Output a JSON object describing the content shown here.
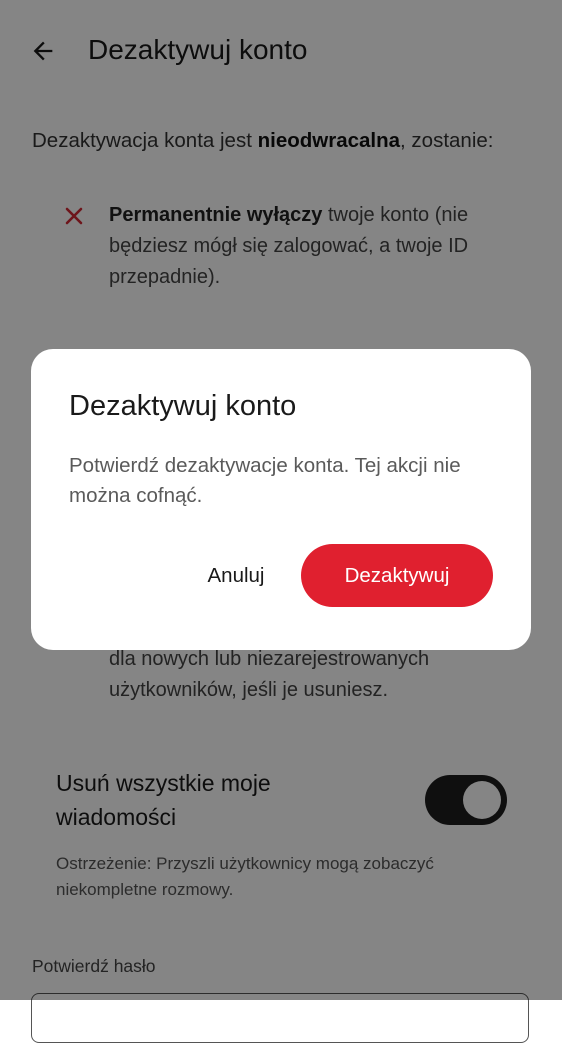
{
  "colors": {
    "accent": "#e0202f",
    "toggle_on": "#1d1d1d",
    "scrim": "rgba(0,0,0,0.48)"
  },
  "header": {
    "back_icon": "arrow-left-icon",
    "title": "Dezaktywuj konto"
  },
  "intro": {
    "prefix": "Dezaktywacja konta jest ",
    "bold": "nieodwracalna",
    "suffix": ", zostanie:"
  },
  "consequences": [
    {
      "icon": "x-icon",
      "bold": "Permanentnie wyłączy",
      "text": " twoje konto (nie będziesz mógł się zalogować, a twoje ID przepadnie)."
    },
    {
      "icon": "x-icon",
      "bold": "",
      "text": "dla nowych lub niezarejestrowanych użytkowników, jeśli je usuniesz."
    }
  ],
  "delete_messages": {
    "label": "Usuń wszystkie moje wiadomości",
    "enabled": true,
    "warning": "Ostrzeżenie: Przyszli użytkownicy mogą zobaczyć niekompletne rozmowy."
  },
  "password": {
    "label": "Potwierdź hasło",
    "value": ""
  },
  "dialog": {
    "title": "Dezaktywuj konto",
    "body": "Potwierdź dezaktywacje konta. Tej akcji nie można cofnąć.",
    "cancel_label": "Anuluj",
    "confirm_label": "Dezaktywuj"
  }
}
